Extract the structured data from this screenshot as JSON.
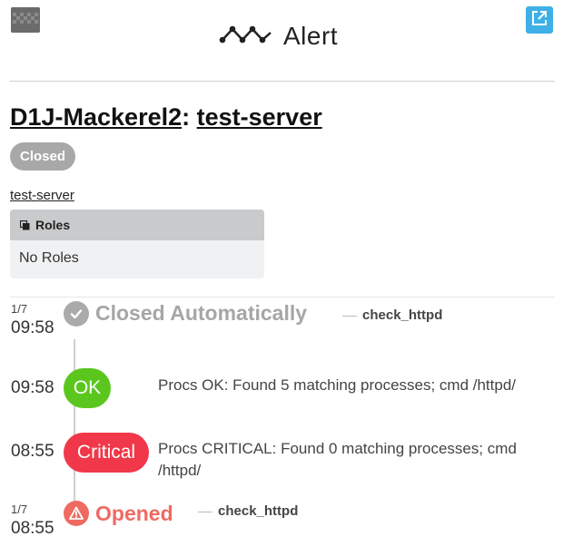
{
  "header": {
    "app_title": "Alert",
    "colors": {
      "external_link": "#3eb0e6",
      "closed": "#a8a8a8",
      "ok": "#5bc71e",
      "critical": "#f0384a",
      "opened": "#ef6a61"
    }
  },
  "alert": {
    "organization": "D1J-Mackerel2",
    "separator": ":",
    "host": "test-server",
    "status": "Closed"
  },
  "host_link": "test-server",
  "roles": {
    "header": "Roles",
    "empty_text": "No Roles"
  },
  "timeline": {
    "closed": {
      "date": "1/7",
      "time": "09:58",
      "title": "Closed Automatically",
      "monitor": "check_httpd",
      "icon": "check-icon"
    },
    "ok": {
      "time": "09:58",
      "status": "OK",
      "message": "Procs OK: Found 5 matching processes; cmd /httpd/"
    },
    "critical": {
      "time": "08:55",
      "status": "Critical",
      "message": "Procs CRITICAL: Found 0 matching processes; cmd /httpd/"
    },
    "opened": {
      "date": "1/7",
      "time": "08:55",
      "title": "Opened",
      "monitor": "check_httpd",
      "icon": "warning-icon"
    }
  }
}
